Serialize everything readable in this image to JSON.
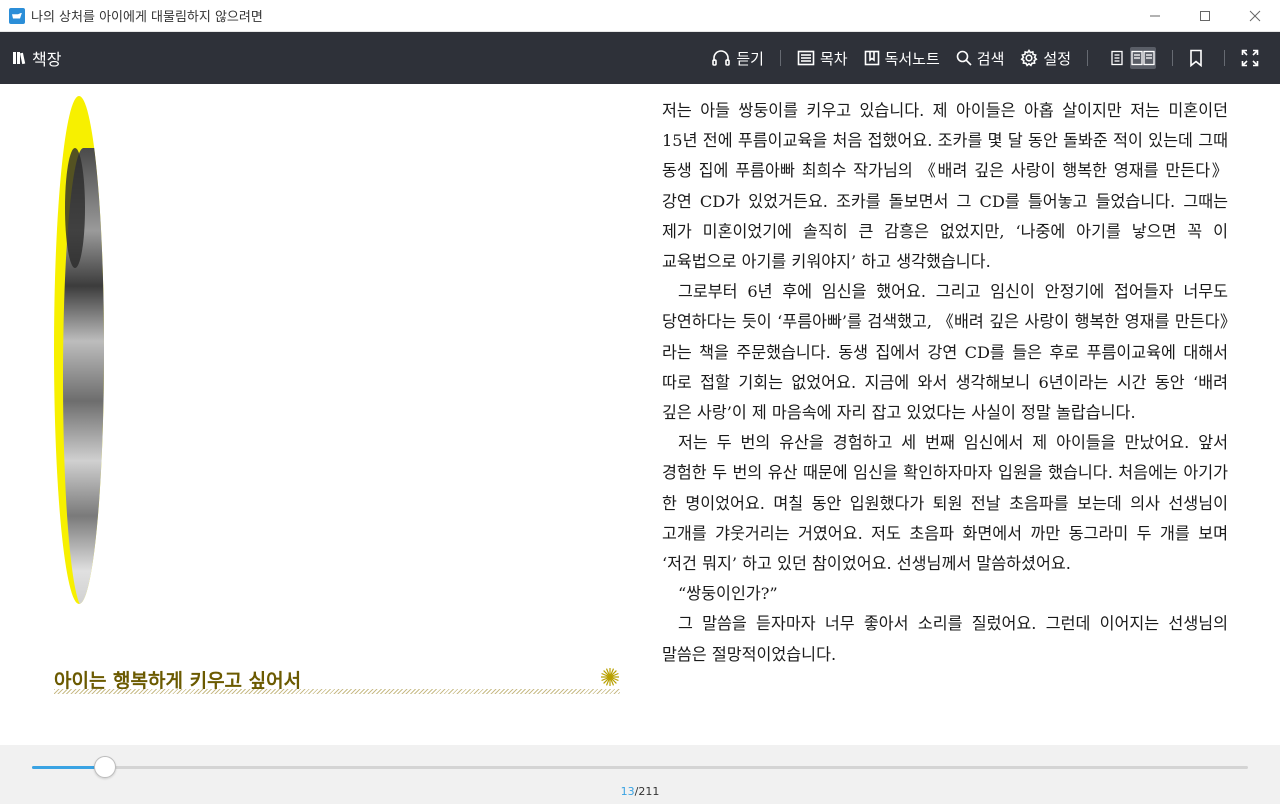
{
  "window": {
    "title": "나의 상처를 아이에게 대물림하지 않으려면",
    "controls": [
      "minimize",
      "maximize",
      "close"
    ]
  },
  "toolbar": {
    "bookshelf_label": "책장",
    "listen_label": "듣기",
    "toc_label": "목차",
    "notes_label": "독서노트",
    "search_label": "검색",
    "settings_label": "설정",
    "view_mode": "two-page"
  },
  "left_page": {
    "chapter_title": "아이는 행복하게 키우고 싶어서",
    "oval_color": "#f7f000"
  },
  "right_page": {
    "paragraphs": [
      "저는 아들 쌍둥이를 키우고 있습니다. 제 아이들은 아홉 살이지만 저는 미혼이던 15년 전에 푸름이교육을 처음 접했어요. 조카를 몇 달 동안 돌봐준 적이 있는데 그때 동생 집에 푸름아빠 최희수 작가님의 《배려 깊은 사랑이 행복한 영재를 만든다》 강연 CD가 있었거든요. 조카를 돌보면서 그 CD를 틀어놓고 들었습니다. 그때는 제가 미혼이었기에 솔직히 큰 감흥은 없었지만, ‘나중에 아기를 낳으면 꼭 이 교육법으로 아기를 키워야지’ 하고 생각했습니다.",
      "그로부터 6년 후에 임신을 했어요. 그리고 임신이 안정기에 접어들자 너무도 당연하다는 듯이 ‘푸름아빠’를 검색했고, 《배려 깊은 사랑이 행복한 영재를 만든다》라는 책을 주문했습니다. 동생 집에서 강연 CD를 들은 후로 푸름이교육에 대해서 따로 접할 기회는 없었어요. 지금에 와서 생각해보니 6년이라는 시간 동안 ‘배려 깊은 사랑’이 제 마음속에 자리 잡고 있었다는 사실이 정말 놀랍습니다.",
      "저는 두 번의 유산을 경험하고 세 번째 임신에서 제 아이들을 만났어요. 앞서 경험한 두 번의 유산 때문에 임신을 확인하자마자 입원을 했습니다. 처음에는 아기가 한 명이었어요. 며칠 동안 입원했다가 퇴원 전날 초음파를 보는데 의사 선생님이 고개를 갸웃거리는 거였어요. 저도 초음파 화면에서 까만 동그라미 두 개를 보며 ‘저건 뭐지’ 하고 있던 참이었어요. 선생님께서 말씀하셨어요.",
      "“쌍둥이인가?”",
      "그 말씀을 듣자마자 너무 좋아서 소리를 질렀어요. 그런데 이어지는 선생님의 말씀은 절망적이었습니다."
    ]
  },
  "progress": {
    "current_page": "13",
    "separator": "/",
    "total_pages": "211",
    "fraction": 0.0604,
    "accent_color": "#3aa3e3"
  }
}
